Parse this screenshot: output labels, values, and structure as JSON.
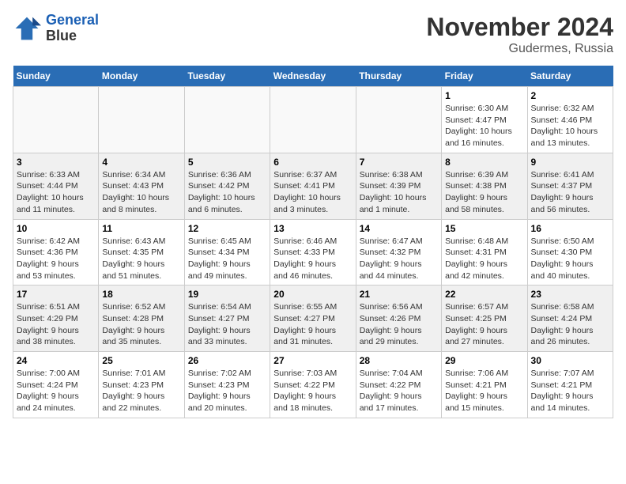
{
  "header": {
    "logo_line1": "General",
    "logo_line2": "Blue",
    "month_title": "November 2024",
    "location": "Gudermes, Russia"
  },
  "weekdays": [
    "Sunday",
    "Monday",
    "Tuesday",
    "Wednesday",
    "Thursday",
    "Friday",
    "Saturday"
  ],
  "weeks": [
    [
      {
        "day": "",
        "info": ""
      },
      {
        "day": "",
        "info": ""
      },
      {
        "day": "",
        "info": ""
      },
      {
        "day": "",
        "info": ""
      },
      {
        "day": "",
        "info": ""
      },
      {
        "day": "1",
        "info": "Sunrise: 6:30 AM\nSunset: 4:47 PM\nDaylight: 10 hours\nand 16 minutes."
      },
      {
        "day": "2",
        "info": "Sunrise: 6:32 AM\nSunset: 4:46 PM\nDaylight: 10 hours\nand 13 minutes."
      }
    ],
    [
      {
        "day": "3",
        "info": "Sunrise: 6:33 AM\nSunset: 4:44 PM\nDaylight: 10 hours\nand 11 minutes."
      },
      {
        "day": "4",
        "info": "Sunrise: 6:34 AM\nSunset: 4:43 PM\nDaylight: 10 hours\nand 8 minutes."
      },
      {
        "day": "5",
        "info": "Sunrise: 6:36 AM\nSunset: 4:42 PM\nDaylight: 10 hours\nand 6 minutes."
      },
      {
        "day": "6",
        "info": "Sunrise: 6:37 AM\nSunset: 4:41 PM\nDaylight: 10 hours\nand 3 minutes."
      },
      {
        "day": "7",
        "info": "Sunrise: 6:38 AM\nSunset: 4:39 PM\nDaylight: 10 hours\nand 1 minute."
      },
      {
        "day": "8",
        "info": "Sunrise: 6:39 AM\nSunset: 4:38 PM\nDaylight: 9 hours\nand 58 minutes."
      },
      {
        "day": "9",
        "info": "Sunrise: 6:41 AM\nSunset: 4:37 PM\nDaylight: 9 hours\nand 56 minutes."
      }
    ],
    [
      {
        "day": "10",
        "info": "Sunrise: 6:42 AM\nSunset: 4:36 PM\nDaylight: 9 hours\nand 53 minutes."
      },
      {
        "day": "11",
        "info": "Sunrise: 6:43 AM\nSunset: 4:35 PM\nDaylight: 9 hours\nand 51 minutes."
      },
      {
        "day": "12",
        "info": "Sunrise: 6:45 AM\nSunset: 4:34 PM\nDaylight: 9 hours\nand 49 minutes."
      },
      {
        "day": "13",
        "info": "Sunrise: 6:46 AM\nSunset: 4:33 PM\nDaylight: 9 hours\nand 46 minutes."
      },
      {
        "day": "14",
        "info": "Sunrise: 6:47 AM\nSunset: 4:32 PM\nDaylight: 9 hours\nand 44 minutes."
      },
      {
        "day": "15",
        "info": "Sunrise: 6:48 AM\nSunset: 4:31 PM\nDaylight: 9 hours\nand 42 minutes."
      },
      {
        "day": "16",
        "info": "Sunrise: 6:50 AM\nSunset: 4:30 PM\nDaylight: 9 hours\nand 40 minutes."
      }
    ],
    [
      {
        "day": "17",
        "info": "Sunrise: 6:51 AM\nSunset: 4:29 PM\nDaylight: 9 hours\nand 38 minutes."
      },
      {
        "day": "18",
        "info": "Sunrise: 6:52 AM\nSunset: 4:28 PM\nDaylight: 9 hours\nand 35 minutes."
      },
      {
        "day": "19",
        "info": "Sunrise: 6:54 AM\nSunset: 4:27 PM\nDaylight: 9 hours\nand 33 minutes."
      },
      {
        "day": "20",
        "info": "Sunrise: 6:55 AM\nSunset: 4:27 PM\nDaylight: 9 hours\nand 31 minutes."
      },
      {
        "day": "21",
        "info": "Sunrise: 6:56 AM\nSunset: 4:26 PM\nDaylight: 9 hours\nand 29 minutes."
      },
      {
        "day": "22",
        "info": "Sunrise: 6:57 AM\nSunset: 4:25 PM\nDaylight: 9 hours\nand 27 minutes."
      },
      {
        "day": "23",
        "info": "Sunrise: 6:58 AM\nSunset: 4:24 PM\nDaylight: 9 hours\nand 26 minutes."
      }
    ],
    [
      {
        "day": "24",
        "info": "Sunrise: 7:00 AM\nSunset: 4:24 PM\nDaylight: 9 hours\nand 24 minutes."
      },
      {
        "day": "25",
        "info": "Sunrise: 7:01 AM\nSunset: 4:23 PM\nDaylight: 9 hours\nand 22 minutes."
      },
      {
        "day": "26",
        "info": "Sunrise: 7:02 AM\nSunset: 4:23 PM\nDaylight: 9 hours\nand 20 minutes."
      },
      {
        "day": "27",
        "info": "Sunrise: 7:03 AM\nSunset: 4:22 PM\nDaylight: 9 hours\nand 18 minutes."
      },
      {
        "day": "28",
        "info": "Sunrise: 7:04 AM\nSunset: 4:22 PM\nDaylight: 9 hours\nand 17 minutes."
      },
      {
        "day": "29",
        "info": "Sunrise: 7:06 AM\nSunset: 4:21 PM\nDaylight: 9 hours\nand 15 minutes."
      },
      {
        "day": "30",
        "info": "Sunrise: 7:07 AM\nSunset: 4:21 PM\nDaylight: 9 hours\nand 14 minutes."
      }
    ]
  ]
}
